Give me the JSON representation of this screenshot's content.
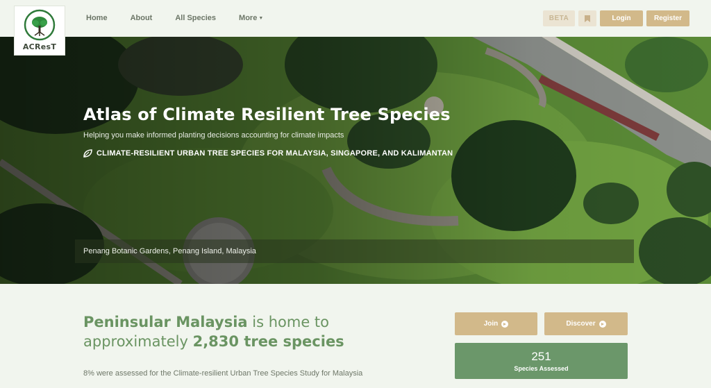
{
  "colors": {
    "page_bg": "#f1f5ee",
    "accent_tan": "#d2b98a",
    "accent_green": "#6b976a",
    "headline_green": "#6a9462"
  },
  "logo": {
    "text": "ACResT",
    "ring_text": "ATLAS OF CLIMATE RESILIENT TREES",
    "icon": "tree-icon"
  },
  "nav": {
    "items": [
      {
        "label": "Home"
      },
      {
        "label": "About"
      },
      {
        "label": "All Species"
      },
      {
        "label": "More",
        "icon": "caret-down-icon"
      }
    ],
    "beta_label": "BETA",
    "bookmark_icon": "bookmark-icon",
    "login_label": "Login",
    "register_label": "Register"
  },
  "hero": {
    "title": "Atlas of Climate Resilient Tree Species",
    "subtitle": "Helping you make informed planting decisions accounting for climate impacts",
    "tagline": "CLIMATE-RESILIENT URBAN TREE SPECIES FOR MALAYSIA, SINGAPORE, AND KALIMANTAN",
    "tagline_icon": "leaf-icon",
    "caption": "Penang Botanic Gardens, Penang Island, Malaysia"
  },
  "stats": {
    "headline_region": "Peninsular Malaysia",
    "headline_mid": " is home to",
    "headline_pre": "approximately ",
    "headline_count": "2,830 tree species",
    "note": "8% were assessed for the Climate-resilient Urban Tree Species Study for Malaysia",
    "join_label": "Join",
    "discover_label": "Discover",
    "arrow_icon": "arrow-circle-right-icon",
    "card_number": "251",
    "card_label": "Species Assessed"
  }
}
